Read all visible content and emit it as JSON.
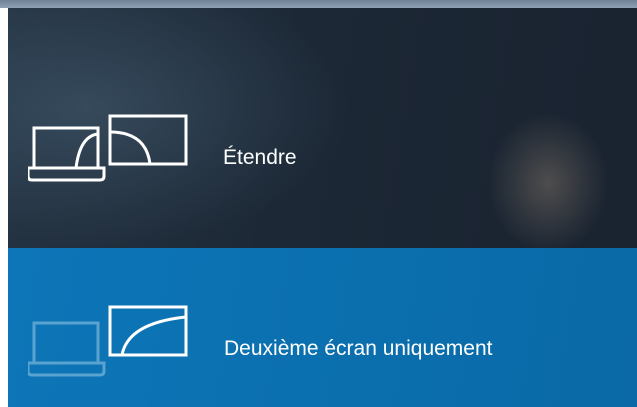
{
  "projection_menu": {
    "options": [
      {
        "label": "Étendre",
        "icon": "extend-display-icon",
        "selected": false
      },
      {
        "label": "Deuxième écran uniquement",
        "icon": "second-screen-only-icon",
        "selected": true
      }
    ]
  },
  "colors": {
    "dark_background": "#1c2836",
    "accent_selected": "#0b6fae",
    "text": "#ffffff",
    "dim_icon": "#5aa2cf"
  }
}
